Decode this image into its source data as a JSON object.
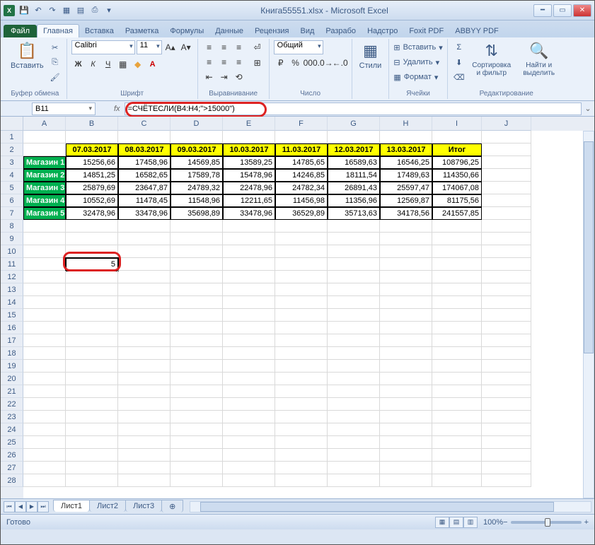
{
  "window": {
    "title": "Книга55551.xlsx - Microsoft Excel"
  },
  "tabs": {
    "file": "Файл",
    "home": "Главная",
    "insert": "Вставка",
    "layout": "Разметка",
    "formulas": "Формулы",
    "data": "Данные",
    "review": "Рецензия",
    "view": "Вид",
    "developer": "Разрабо",
    "addins": "Надстро",
    "foxit": "Foxit PDF",
    "abbyy": "ABBYY PDF"
  },
  "ribbon": {
    "clipboard": {
      "label": "Буфер обмена",
      "paste": "Вставить"
    },
    "font": {
      "label": "Шрифт",
      "name": "Calibri",
      "size": "11"
    },
    "alignment": {
      "label": "Выравнивание"
    },
    "number": {
      "label": "Число",
      "format": "Общий"
    },
    "styles": {
      "label": "Стили",
      "btn": "Стили"
    },
    "cells": {
      "label": "Ячейки",
      "insert": "Вставить",
      "delete": "Удалить",
      "format": "Формат"
    },
    "editing": {
      "label": "Редактирование",
      "sort": "Сортировка и фильтр",
      "find": "Найти и выделить"
    }
  },
  "namebox": "B11",
  "formula": "=СЧЁТЕСЛИ(B4:H4;\">15000\")",
  "columns": [
    "A",
    "B",
    "C",
    "D",
    "E",
    "F",
    "G",
    "H",
    "I",
    "J"
  ],
  "col_widths": [
    "colA",
    "colB",
    "colC",
    "colD",
    "colE",
    "colF",
    "colG",
    "colH",
    "colI",
    "colJ"
  ],
  "row_count": 28,
  "header_row": [
    "",
    "07.03.2017",
    "08.03.2017",
    "09.03.2017",
    "10.03.2017",
    "11.03.2017",
    "12.03.2017",
    "13.03.2017",
    "Итог"
  ],
  "data_rows": [
    {
      "name": "Магазин 1",
      "vals": [
        "15256,66",
        "17458,96",
        "14569,85",
        "13589,25",
        "14785,65",
        "16589,63",
        "16546,25",
        "108796,25"
      ]
    },
    {
      "name": "Магазин 2",
      "vals": [
        "14851,25",
        "16582,65",
        "17589,78",
        "15478,96",
        "14246,85",
        "18111,54",
        "17489,63",
        "114350,66"
      ]
    },
    {
      "name": "Магазин 3",
      "vals": [
        "25879,69",
        "23647,87",
        "24789,32",
        "22478,96",
        "24782,34",
        "26891,43",
        "25597,47",
        "174067,08"
      ]
    },
    {
      "name": "Магазин 4",
      "vals": [
        "10552,69",
        "11478,45",
        "11548,96",
        "12211,65",
        "11456,98",
        "11356,96",
        "12569,87",
        "81175,56"
      ]
    },
    {
      "name": "Магазин 5",
      "vals": [
        "32478,96",
        "33478,96",
        "35698,89",
        "33478,96",
        "36529,89",
        "35713,63",
        "34178,56",
        "241557,85"
      ]
    }
  ],
  "result_cell": {
    "row": 11,
    "col": "B",
    "value": "5"
  },
  "sheets": {
    "s1": "Лист1",
    "s2": "Лист2",
    "s3": "Лист3"
  },
  "status": {
    "ready": "Готово",
    "zoom": "100%"
  },
  "chart_data": {
    "type": "table",
    "title": "",
    "columns": [
      "Магазин",
      "07.03.2017",
      "08.03.2017",
      "09.03.2017",
      "10.03.2017",
      "11.03.2017",
      "12.03.2017",
      "13.03.2017",
      "Итог"
    ],
    "rows": [
      [
        "Магазин 1",
        15256.66,
        17458.96,
        14569.85,
        13589.25,
        14785.65,
        16589.63,
        16546.25,
        108796.25
      ],
      [
        "Магазин 2",
        14851.25,
        16582.65,
        17589.78,
        15478.96,
        14246.85,
        18111.54,
        17489.63,
        114350.66
      ],
      [
        "Магазин 3",
        25879.69,
        23647.87,
        24789.32,
        22478.96,
        24782.34,
        26891.43,
        25597.47,
        174067.08
      ],
      [
        "Магазин 4",
        10552.69,
        11478.45,
        11548.96,
        12211.65,
        11456.98,
        11356.96,
        12569.87,
        81175.56
      ],
      [
        "Магазин 5",
        32478.96,
        33478.96,
        35698.89,
        33478.96,
        36529.89,
        35713.63,
        34178.56,
        241557.85
      ]
    ]
  }
}
